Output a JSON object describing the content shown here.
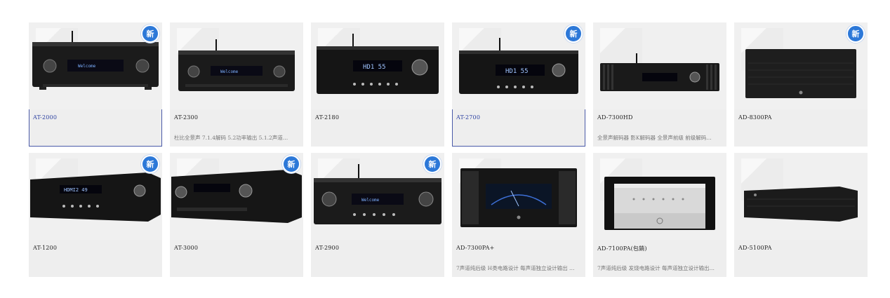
{
  "badge_label": "新",
  "products": [
    {
      "title": "AT-2000",
      "desc": "",
      "new": true,
      "selected": true,
      "image": "receiver-front-antenna"
    },
    {
      "title": "AT-2300",
      "desc": "杜比全景声 7.1.4解码 5.2功率输出 5.1.2声道…",
      "new": false,
      "selected": false,
      "image": "receiver-front-antenna"
    },
    {
      "title": "AT-2180",
      "desc": "",
      "new": false,
      "selected": false,
      "image": "receiver-hd1-display"
    },
    {
      "title": "AT-2700",
      "desc": "",
      "new": true,
      "selected": true,
      "image": "receiver-hd1-display"
    },
    {
      "title": "AD-7300HD",
      "desc": "全景声解码器 影K解码器 全景声前级 前级解码…",
      "new": false,
      "selected": false,
      "image": "decoder-front-finned"
    },
    {
      "title": "AD-8300PA",
      "desc": "",
      "new": true,
      "selected": false,
      "image": "power-amp-dark"
    },
    {
      "title": "AT-1200",
      "desc": "",
      "new": true,
      "selected": false,
      "image": "receiver-perspective"
    },
    {
      "title": "AT-3000",
      "desc": "",
      "new": true,
      "selected": false,
      "image": "receiver-perspective"
    },
    {
      "title": "AT-2900",
      "desc": "",
      "new": true,
      "selected": false,
      "image": "receiver-front-antenna"
    },
    {
      "title": "AD-7300PA+",
      "desc": "7声道纯后级 H类电路设计 每声道独立设计输出 …",
      "new": false,
      "selected": false,
      "image": "power-amp-vu"
    },
    {
      "title": "AD-7100PA(包銷)",
      "desc": "7声道纯后级 发烧电路设计 每声道独立设计输出…",
      "new": false,
      "selected": false,
      "image": "power-amp-silver"
    },
    {
      "title": "AD-5100PA",
      "desc": "",
      "new": false,
      "selected": false,
      "image": "power-amp-slim"
    }
  ]
}
